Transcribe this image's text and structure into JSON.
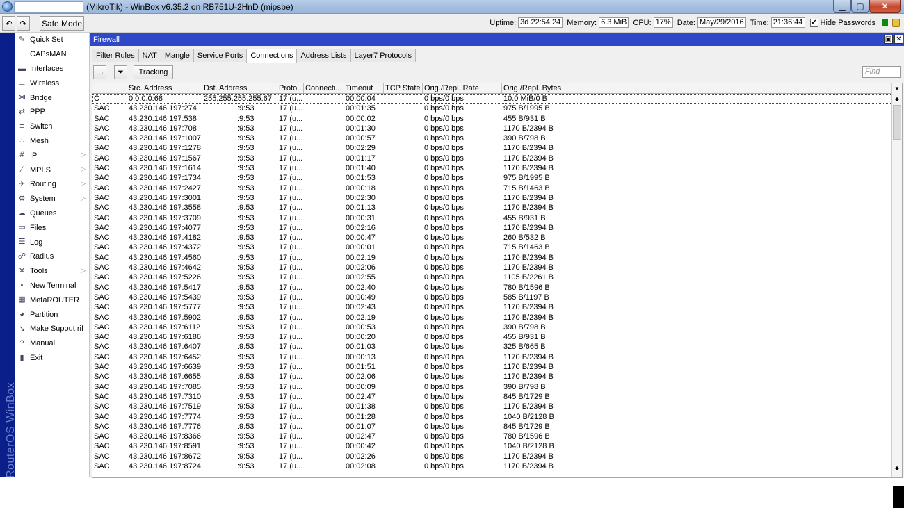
{
  "window": {
    "title": "(MikroTik) - WinBox v6.35.2 on RB751U-2HnD (mipsbe)",
    "min_icon": "minimize-icon",
    "max_icon": "maximize-icon",
    "close_icon": "close-icon"
  },
  "toolbar": {
    "undo_icon": "undo-icon",
    "redo_icon": "redo-icon",
    "safe_mode_label": "Safe Mode",
    "uptime_label": "Uptime:",
    "uptime": "3d 22:54:24",
    "memory_label": "Memory:",
    "memory": "6.3 MiB",
    "cpu_label": "CPU:",
    "cpu": "17%",
    "date_label": "Date:",
    "date": "May/29/2016",
    "time_label": "Time:",
    "time": "21:36:44",
    "hide_passwords_label": "Hide Passwords",
    "hide_passwords_checked": true
  },
  "brand": {
    "text": "RouterOS WinBox"
  },
  "menu": {
    "items": [
      {
        "label": "Quick Set",
        "icon": "magic-wand-icon",
        "glyph": "✎",
        "submenu": false
      },
      {
        "label": "CAPsMAN",
        "icon": "antenna-icon",
        "glyph": "⊥",
        "submenu": false
      },
      {
        "label": "Interfaces",
        "icon": "interfaces-icon",
        "glyph": "▬",
        "submenu": false
      },
      {
        "label": "Wireless",
        "icon": "wireless-icon",
        "glyph": "⊥",
        "submenu": false
      },
      {
        "label": "Bridge",
        "icon": "bridge-icon",
        "glyph": "⋈",
        "submenu": false
      },
      {
        "label": "PPP",
        "icon": "ppp-icon",
        "glyph": "⇄",
        "submenu": false
      },
      {
        "label": "Switch",
        "icon": "switch-icon",
        "glyph": "≡",
        "submenu": false
      },
      {
        "label": "Mesh",
        "icon": "mesh-icon",
        "glyph": "∴",
        "submenu": false
      },
      {
        "label": "IP",
        "icon": "ip-icon",
        "glyph": "#",
        "submenu": true
      },
      {
        "label": "MPLS",
        "icon": "mpls-icon",
        "glyph": "⁄",
        "submenu": true
      },
      {
        "label": "Routing",
        "icon": "routing-icon",
        "glyph": "✈",
        "submenu": true
      },
      {
        "label": "System",
        "icon": "system-icon",
        "glyph": "⚙",
        "submenu": true
      },
      {
        "label": "Queues",
        "icon": "queues-icon",
        "glyph": "☁",
        "submenu": false
      },
      {
        "label": "Files",
        "icon": "files-icon",
        "glyph": "▭",
        "submenu": false
      },
      {
        "label": "Log",
        "icon": "log-icon",
        "glyph": "☰",
        "submenu": false
      },
      {
        "label": "Radius",
        "icon": "radius-icon",
        "glyph": "☍",
        "submenu": false
      },
      {
        "label": "Tools",
        "icon": "tools-icon",
        "glyph": "✕",
        "submenu": true
      },
      {
        "label": "New Terminal",
        "icon": "terminal-icon",
        "glyph": "▪",
        "submenu": false
      },
      {
        "label": "MetaROUTER",
        "icon": "metarouter-icon",
        "glyph": "▦",
        "submenu": false
      },
      {
        "label": "Partition",
        "icon": "partition-icon",
        "glyph": "◕",
        "submenu": false
      },
      {
        "label": "Make Supout.rif",
        "icon": "supout-icon",
        "glyph": "↘",
        "submenu": false
      },
      {
        "label": "Manual",
        "icon": "help-icon",
        "glyph": "?",
        "submenu": false
      },
      {
        "label": "Exit",
        "icon": "exit-icon",
        "glyph": "▮",
        "submenu": false
      }
    ]
  },
  "firewall": {
    "title": "Firewall",
    "tabs": [
      "Filter Rules",
      "NAT",
      "Mangle",
      "Service Ports",
      "Connections",
      "Address Lists",
      "Layer7 Protocols"
    ],
    "active_tab": 4,
    "tracking_label": "Tracking",
    "find_placeholder": "Find",
    "columns": [
      "",
      "Src. Address",
      "Dst. Address",
      "Proto...",
      "Connecti...",
      "Timeout",
      "TCP State",
      "Orig./Repl. Rate",
      "Orig./Repl. Bytes",
      ""
    ],
    "rows": [
      [
        "C",
        "0.0.0.0:68",
        "255.255.255.255:67",
        "17 (u...",
        "",
        "00:00:04",
        "",
        "0 bps/0 bps",
        "10.0 MiB/0 B"
      ],
      [
        "SAC",
        "43.230.146.197:274",
        ":9:53",
        "17 (u...",
        "",
        "00:01:35",
        "",
        "0 bps/0 bps",
        "975 B/1995 B"
      ],
      [
        "SAC",
        "43.230.146.197:538",
        ":9:53",
        "17 (u...",
        "",
        "00:00:02",
        "",
        "0 bps/0 bps",
        "455 B/931 B"
      ],
      [
        "SAC",
        "43.230.146.197:708",
        ":9:53",
        "17 (u...",
        "",
        "00:01:30",
        "",
        "0 bps/0 bps",
        "1170 B/2394 B"
      ],
      [
        "SAC",
        "43.230.146.197:1007",
        ":9:53",
        "17 (u...",
        "",
        "00:00:57",
        "",
        "0 bps/0 bps",
        "390 B/798 B"
      ],
      [
        "SAC",
        "43.230.146.197:1278",
        ":9:53",
        "17 (u...",
        "",
        "00:02:29",
        "",
        "0 bps/0 bps",
        "1170 B/2394 B"
      ],
      [
        "SAC",
        "43.230.146.197:1567",
        ":9:53",
        "17 (u...",
        "",
        "00:01:17",
        "",
        "0 bps/0 bps",
        "1170 B/2394 B"
      ],
      [
        "SAC",
        "43.230.146.197:1614",
        ":9:53",
        "17 (u...",
        "",
        "00:01:40",
        "",
        "0 bps/0 bps",
        "1170 B/2394 B"
      ],
      [
        "SAC",
        "43.230.146.197:1734",
        ":9:53",
        "17 (u...",
        "",
        "00:01:53",
        "",
        "0 bps/0 bps",
        "975 B/1995 B"
      ],
      [
        "SAC",
        "43.230.146.197:2427",
        ":9:53",
        "17 (u...",
        "",
        "00:00:18",
        "",
        "0 bps/0 bps",
        "715 B/1463 B"
      ],
      [
        "SAC",
        "43.230.146.197:3001",
        ":9:53",
        "17 (u...",
        "",
        "00:02:30",
        "",
        "0 bps/0 bps",
        "1170 B/2394 B"
      ],
      [
        "SAC",
        "43.230.146.197:3558",
        ":9:53",
        "17 (u...",
        "",
        "00:01:13",
        "",
        "0 bps/0 bps",
        "1170 B/2394 B"
      ],
      [
        "SAC",
        "43.230.146.197:3709",
        ":9:53",
        "17 (u...",
        "",
        "00:00:31",
        "",
        "0 bps/0 bps",
        "455 B/931 B"
      ],
      [
        "SAC",
        "43.230.146.197:4077",
        ":9:53",
        "17 (u...",
        "",
        "00:02:16",
        "",
        "0 bps/0 bps",
        "1170 B/2394 B"
      ],
      [
        "SAC",
        "43.230.146.197:4182",
        ":9:53",
        "17 (u...",
        "",
        "00:00:47",
        "",
        "0 bps/0 bps",
        "260 B/532 B"
      ],
      [
        "SAC",
        "43.230.146.197:4372",
        ":9:53",
        "17 (u...",
        "",
        "00:00:01",
        "",
        "0 bps/0 bps",
        "715 B/1463 B"
      ],
      [
        "SAC",
        "43.230.146.197:4560",
        ":9:53",
        "17 (u...",
        "",
        "00:02:19",
        "",
        "0 bps/0 bps",
        "1170 B/2394 B"
      ],
      [
        "SAC",
        "43.230.146.197:4642",
        ":9:53",
        "17 (u...",
        "",
        "00:02:06",
        "",
        "0 bps/0 bps",
        "1170 B/2394 B"
      ],
      [
        "SAC",
        "43.230.146.197:5226",
        ":9:53",
        "17 (u...",
        "",
        "00:02:55",
        "",
        "0 bps/0 bps",
        "1105 B/2261 B"
      ],
      [
        "SAC",
        "43.230.146.197:5417",
        ":9:53",
        "17 (u...",
        "",
        "00:02:40",
        "",
        "0 bps/0 bps",
        "780 B/1596 B"
      ],
      [
        "SAC",
        "43.230.146.197:5439",
        ":9:53",
        "17 (u...",
        "",
        "00:00:49",
        "",
        "0 bps/0 bps",
        "585 B/1197 B"
      ],
      [
        "SAC",
        "43.230.146.197:5777",
        ":9:53",
        "17 (u...",
        "",
        "00:02:43",
        "",
        "0 bps/0 bps",
        "1170 B/2394 B"
      ],
      [
        "SAC",
        "43.230.146.197:5902",
        ":9:53",
        "17 (u...",
        "",
        "00:02:19",
        "",
        "0 bps/0 bps",
        "1170 B/2394 B"
      ],
      [
        "SAC",
        "43.230.146.197:6112",
        ":9:53",
        "17 (u...",
        "",
        "00:00:53",
        "",
        "0 bps/0 bps",
        "390 B/798 B"
      ],
      [
        "SAC",
        "43.230.146.197:6186",
        ":9:53",
        "17 (u...",
        "",
        "00:00:20",
        "",
        "0 bps/0 bps",
        "455 B/931 B"
      ],
      [
        "SAC",
        "43.230.146.197:6407",
        ":9:53",
        "17 (u...",
        "",
        "00:01:03",
        "",
        "0 bps/0 bps",
        "325 B/665 B"
      ],
      [
        "SAC",
        "43.230.146.197:6452",
        ":9:53",
        "17 (u...",
        "",
        "00:00:13",
        "",
        "0 bps/0 bps",
        "1170 B/2394 B"
      ],
      [
        "SAC",
        "43.230.146.197:6639",
        ":9:53",
        "17 (u...",
        "",
        "00:01:51",
        "",
        "0 bps/0 bps",
        "1170 B/2394 B"
      ],
      [
        "SAC",
        "43.230.146.197:6655",
        ":9:53",
        "17 (u...",
        "",
        "00:02:06",
        "",
        "0 bps/0 bps",
        "1170 B/2394 B"
      ],
      [
        "SAC",
        "43.230.146.197:7085",
        ":9:53",
        "17 (u...",
        "",
        "00:00:09",
        "",
        "0 bps/0 bps",
        "390 B/798 B"
      ],
      [
        "SAC",
        "43.230.146.197:7310",
        ":9:53",
        "17 (u...",
        "",
        "00:02:47",
        "",
        "0 bps/0 bps",
        "845 B/1729 B"
      ],
      [
        "SAC",
        "43.230.146.197:7519",
        ":9:53",
        "17 (u...",
        "",
        "00:01:38",
        "",
        "0 bps/0 bps",
        "1170 B/2394 B"
      ],
      [
        "SAC",
        "43.230.146.197:7774",
        ":9:53",
        "17 (u...",
        "",
        "00:01:28",
        "",
        "0 bps/0 bps",
        "1040 B/2128 B"
      ],
      [
        "SAC",
        "43.230.146.197:7776",
        ":9:53",
        "17 (u...",
        "",
        "00:01:07",
        "",
        "0 bps/0 bps",
        "845 B/1729 B"
      ],
      [
        "SAC",
        "43.230.146.197:8366",
        ":9:53",
        "17 (u...",
        "",
        "00:02:47",
        "",
        "0 bps/0 bps",
        "780 B/1596 B"
      ],
      [
        "SAC",
        "43.230.146.197:8591",
        ":9:53",
        "17 (u...",
        "",
        "00:00:42",
        "",
        "0 bps/0 bps",
        "1040 B/2128 B"
      ],
      [
        "SAC",
        "43.230.146.197:8672",
        ":9:53",
        "17 (u...",
        "",
        "00:02:26",
        "",
        "0 bps/0 bps",
        "1170 B/2394 B"
      ],
      [
        "SAC",
        "43.230.146.197:8724",
        ":9:53",
        "17 (u...",
        "",
        "00:02:08",
        "",
        "0 bps/0 bps",
        "1170 B/2394 B"
      ]
    ]
  }
}
